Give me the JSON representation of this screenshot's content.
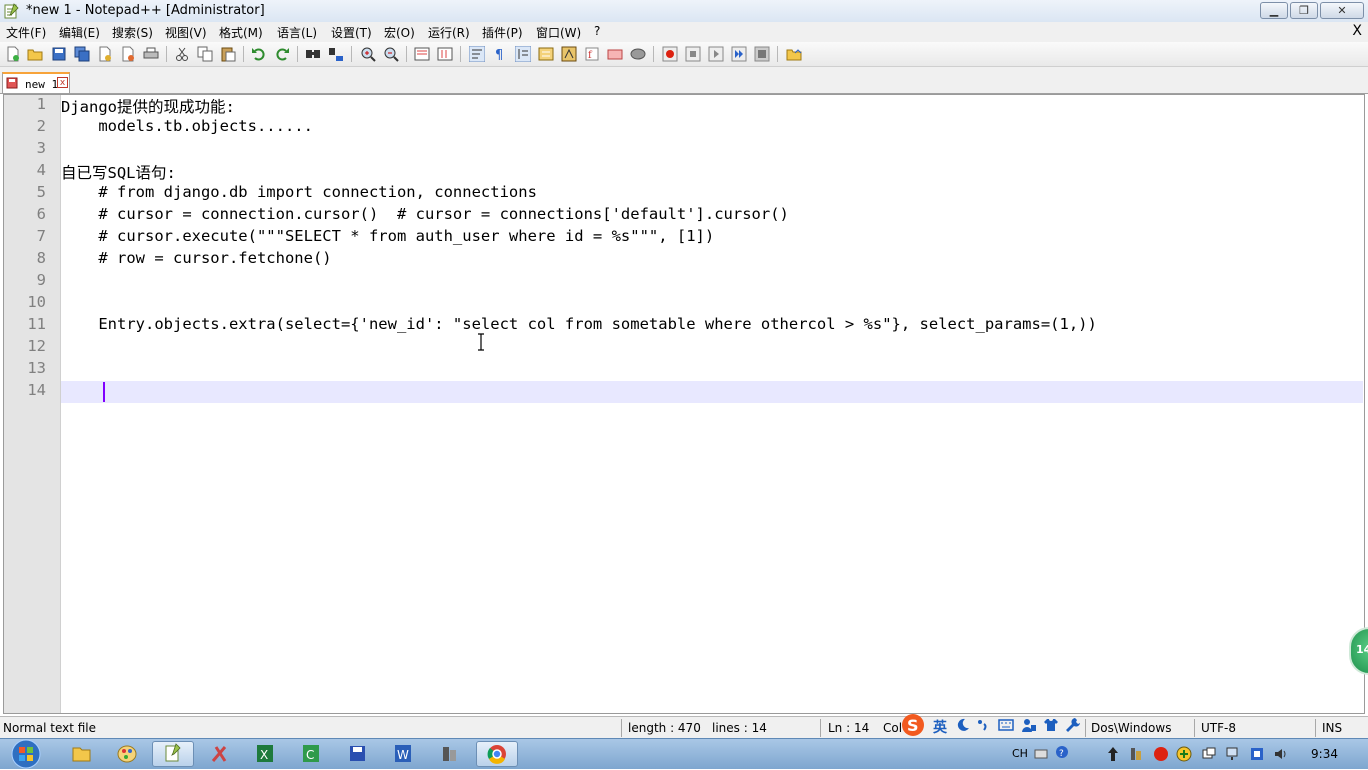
{
  "window": {
    "title": "*new 1 - Notepad++ [Administrator]",
    "min_glyph": "▁",
    "max_glyph": "❐",
    "close_glyph": "✕"
  },
  "menu": {
    "items": [
      "文件(F)",
      "编辑(E)",
      "搜索(S)",
      "视图(V)",
      "格式(M)",
      "语言(L)",
      "设置(T)",
      "宏(O)",
      "运行(R)",
      "插件(P)",
      "窗口(W)",
      "?"
    ],
    "close_glyph": "X"
  },
  "toolbar": {
    "icons": [
      "new-file-icon",
      "open-file-icon",
      "save-icon",
      "save-all-icon",
      "close-icon",
      "close-all-icon",
      "print-icon",
      "cut-icon",
      "copy-icon",
      "paste-icon",
      "undo-icon",
      "redo-icon",
      "find-icon",
      "replace-icon",
      "zoom-in-icon",
      "zoom-out-icon",
      "sync-vertical-icon",
      "sync-horizontal-icon",
      "word-wrap-icon",
      "show-all-chars-icon",
      "indent-guide-icon",
      "lang-define-icon",
      "doc-map-icon",
      "function-list-icon",
      "folder-workspace-icon",
      "monitor-icon",
      "record-macro-icon",
      "stop-record-icon",
      "play-macro-icon",
      "run-macro-multiple-icon",
      "save-macro-icon",
      "open-folder-icon"
    ]
  },
  "tab": {
    "label": "new 1",
    "close_glyph": "x"
  },
  "editor": {
    "lines": [
      {
        "n": "1",
        "text": "Django提供的现成功能:"
      },
      {
        "n": "2",
        "text": "    models.tb.objects......"
      },
      {
        "n": "3",
        "text": ""
      },
      {
        "n": "4",
        "text": "自已写SQL语句:"
      },
      {
        "n": "5",
        "text": "    # from django.db import connection, connections"
      },
      {
        "n": "6",
        "text": "    # cursor = connection.cursor()  # cursor = connections['default'].cursor()"
      },
      {
        "n": "7",
        "text": "    # cursor.execute(\"\"\"SELECT * from auth_user where id = %s\"\"\", [1])"
      },
      {
        "n": "8",
        "text": "    # row = cursor.fetchone()"
      },
      {
        "n": "9",
        "text": ""
      },
      {
        "n": "10",
        "text": ""
      },
      {
        "n": "11",
        "text": "    Entry.objects.extra(select={'new_id': \"select col from sometable where othercol > %s\"}, select_params=(1,))"
      },
      {
        "n": "12",
        "text": ""
      },
      {
        "n": "13",
        "text": ""
      },
      {
        "n": "14",
        "text": ""
      }
    ]
  },
  "status": {
    "file_type": "Normal text file",
    "length": "length : 470",
    "lines": "lines : 14",
    "ln": "Ln : 14",
    "col": "Col",
    "eol": "Dos\\Windows",
    "encoding": "UTF-8",
    "mode": "INS"
  },
  "ime": {
    "logo": "S",
    "lang": "英"
  },
  "badge": {
    "text": "14"
  },
  "taskbar": {
    "apps": [
      "explorer-icon",
      "paint-icon",
      "notepadpp-icon",
      "tool-icon",
      "excel-icon",
      "c-app-icon",
      "save-app-icon",
      "word-icon",
      "tool2-icon",
      "chrome-icon"
    ],
    "tray_lang": "CH",
    "clock": "9:34"
  }
}
